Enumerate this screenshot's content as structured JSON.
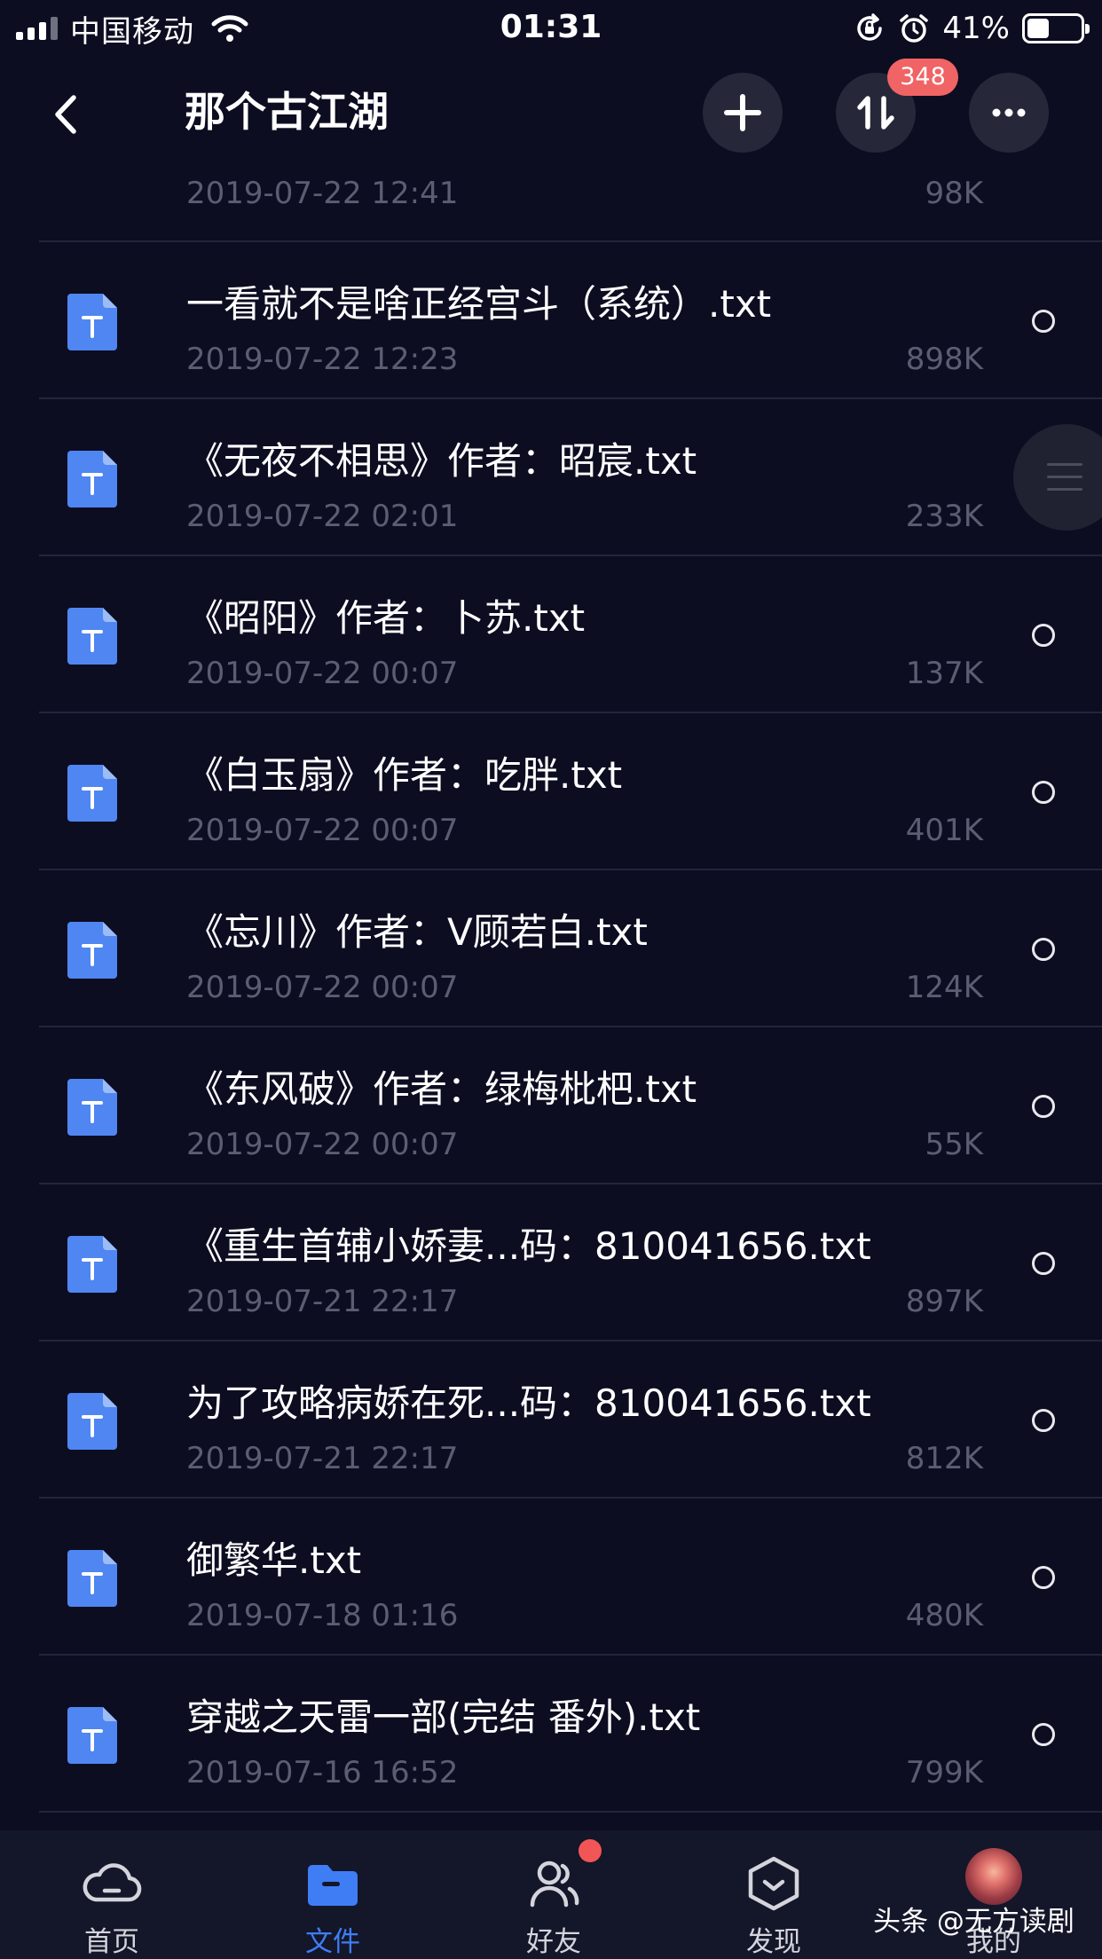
{
  "status_bar": {
    "carrier": "中国移动",
    "time": "01:31",
    "battery_percent": "41%",
    "battery_level": 0.41
  },
  "nav": {
    "title": "那个古江湖",
    "transfer_badge": "348"
  },
  "files": [
    {
      "name": "",
      "date": "2019-07-22 12:41",
      "size": "98K"
    },
    {
      "name": "一看就不是啥正经宫斗（系统）.txt",
      "date": "2019-07-22 12:23",
      "size": "898K"
    },
    {
      "name": "《无夜不相思》作者：昭宸.txt",
      "date": "2019-07-22 02:01",
      "size": "233K"
    },
    {
      "name": "《昭阳》作者：卜苏.txt",
      "date": "2019-07-22 00:07",
      "size": "137K"
    },
    {
      "name": "《白玉扇》作者：吃胖.txt",
      "date": "2019-07-22 00:07",
      "size": "401K"
    },
    {
      "name": "《忘川》作者：V顾若白.txt",
      "date": "2019-07-22 00:07",
      "size": "124K"
    },
    {
      "name": "《东风破》作者：绿梅枇杷.txt",
      "date": "2019-07-22 00:07",
      "size": "55K"
    },
    {
      "name": "《重生首辅小娇妻...码：810041656.txt",
      "date": "2019-07-21 22:17",
      "size": "897K"
    },
    {
      "name": "为了攻略病娇在死...码：810041656.txt",
      "date": "2019-07-21 22:17",
      "size": "812K"
    },
    {
      "name": "御繁华.txt",
      "date": "2019-07-18 01:16",
      "size": "480K"
    },
    {
      "name": "穿越之天雷一部(完结 番外).txt",
      "date": "2019-07-16 16:52",
      "size": "799K"
    }
  ],
  "tabs": [
    {
      "label": "首页",
      "icon": "cloud-icon"
    },
    {
      "label": "文件",
      "icon": "folder-icon"
    },
    {
      "label": "好友",
      "icon": "friends-icon"
    },
    {
      "label": "发现",
      "icon": "discover-icon"
    },
    {
      "label": "我的",
      "icon": "avatar"
    }
  ],
  "watermark": "头条 @无方读剧",
  "colors": {
    "background": "#0c0d21",
    "accent": "#3f7df5",
    "badge": "#f06465",
    "file_icon": "#4f86f2",
    "secondary_text": "#5b5e72"
  }
}
